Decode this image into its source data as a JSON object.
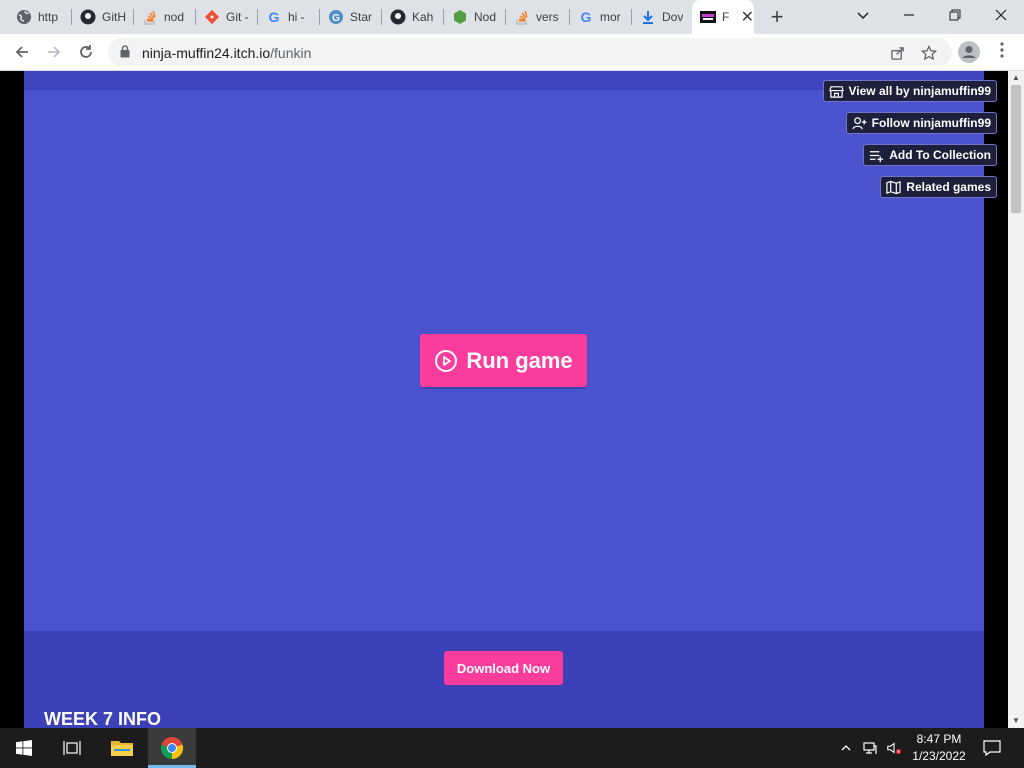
{
  "browser": {
    "tabs": [
      {
        "title": "http",
        "icon": "globe-icon"
      },
      {
        "title": "GitH",
        "icon": "github-icon"
      },
      {
        "title": "nod",
        "icon": "stackoverflow-icon"
      },
      {
        "title": "Git -",
        "icon": "git-icon"
      },
      {
        "title": "hi -",
        "icon": "google-icon"
      },
      {
        "title": "Star",
        "icon": "grammarly-icon"
      },
      {
        "title": "Kah",
        "icon": "github-icon"
      },
      {
        "title": "Nod",
        "icon": "nodejs-icon"
      },
      {
        "title": "vers",
        "icon": "stackoverflow-icon"
      },
      {
        "title": "mor",
        "icon": "google-icon"
      },
      {
        "title": "Dov",
        "icon": "download-icon"
      },
      {
        "title": "F",
        "icon": "fnf-icon",
        "active": true
      }
    ],
    "url_domain": "ninja-muffin24.itch.io",
    "url_path": "/funkin"
  },
  "page": {
    "run_game_label": "Run game",
    "download_label": "Download Now",
    "section_heading": "WEEK 7 INFO",
    "sidebar_buttons": {
      "view_all": "View all by ninjamuffin99",
      "follow": "Follow ninjamuffin99",
      "add_collection": "Add To Collection",
      "related": "Related games"
    },
    "colors": {
      "frame_bg": "#4a52cd",
      "page_bg": "#3c41b8",
      "button_pink": "#fa3c9d"
    }
  },
  "taskbar": {
    "time": "8:47 PM",
    "date": "1/23/2022"
  }
}
